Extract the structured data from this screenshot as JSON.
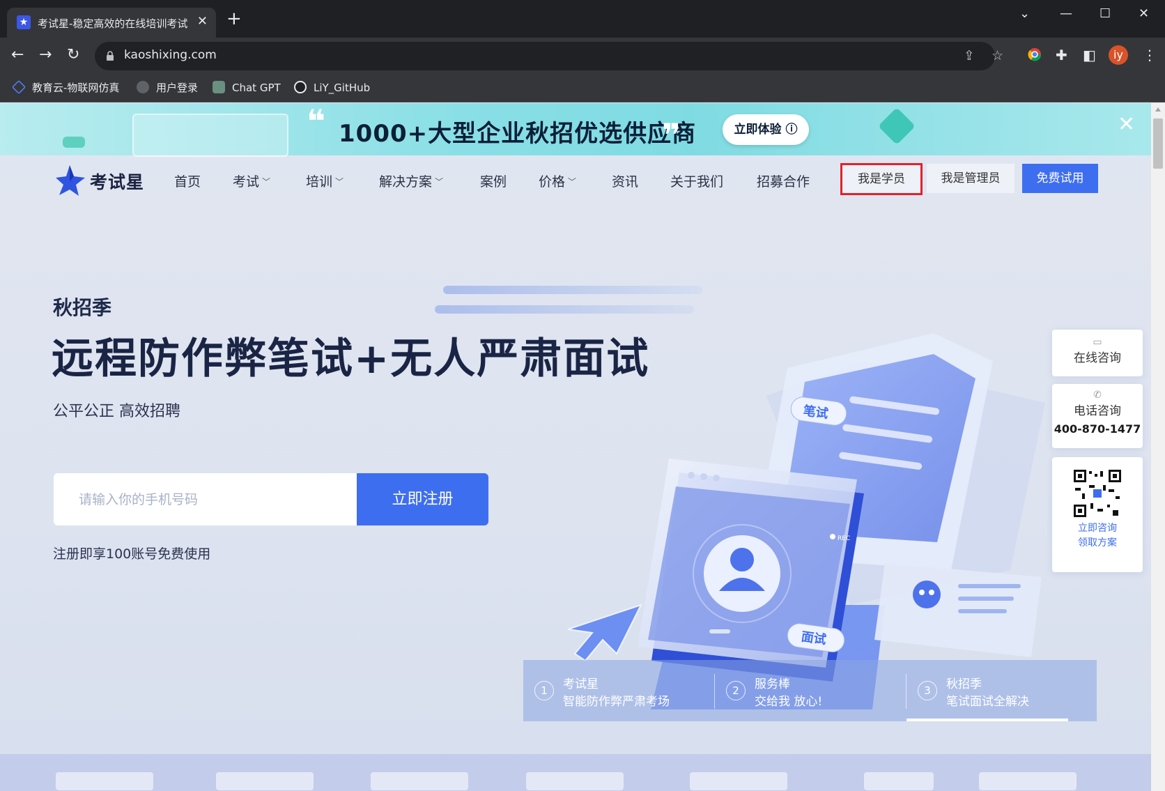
{
  "browser": {
    "tab_title": "考试星-稳定高效的在线培训考试",
    "tab_favicon": "★",
    "tab_close": "✕",
    "new_tab": "+",
    "url": "kaoshixing.com",
    "profile_initials": "iy",
    "window_controls": {
      "tab_search": "⌄",
      "minimize": "—",
      "maximize": "☐",
      "close": "✕"
    },
    "bookmarks": [
      {
        "label": "教育云-物联网仿真",
        "icon": "diamond-icon"
      },
      {
        "label": "用户登录",
        "icon": "globe-icon"
      },
      {
        "label": "Chat GPT",
        "icon": "openai-icon"
      },
      {
        "label": "LiY_GitHub",
        "icon": "github-icon"
      }
    ]
  },
  "promo": {
    "text": "1000+大型企业秋招优选供应商",
    "button": "立即体验 ⓘ",
    "quote_open": "❝",
    "quote_close": "❞",
    "close": "✕"
  },
  "nav": {
    "logo": "考试星",
    "items": [
      {
        "label": "首页",
        "caret": false
      },
      {
        "label": "考试",
        "caret": true
      },
      {
        "label": "培训",
        "caret": true
      },
      {
        "label": "解决方案",
        "caret": true
      },
      {
        "label": "案例",
        "caret": false
      },
      {
        "label": "价格",
        "caret": true
      },
      {
        "label": "资讯",
        "caret": false
      },
      {
        "label": "关于我们",
        "caret": false
      },
      {
        "label": "招募合作",
        "caret": false
      }
    ],
    "btn_student": "我是学员",
    "btn_admin": "我是管理员",
    "btn_trial": "免费试用"
  },
  "hero": {
    "kicker": "秋招季",
    "title": "远程防作弊笔试+无人严肃面试",
    "subtitle": "公平公正 高效招聘",
    "phone_placeholder": "请输入你的手机号码",
    "register": "立即注册",
    "note": "注册即享100账号免费使用",
    "illus_tag_written": "笔试",
    "illus_tag_interview": "面试",
    "illus_rec": "REC"
  },
  "side": {
    "online": "在线咨询",
    "phone_label": "电话咨询",
    "phone_number": "400-870-1477",
    "qr_link_1": "立即咨询",
    "qr_link_2": "领取方案"
  },
  "features": [
    {
      "num": "1",
      "title": "考试星",
      "desc": "智能防作弊严肃考场"
    },
    {
      "num": "2",
      "title": "服务棒",
      "desc": "交给我 放心!"
    },
    {
      "num": "3",
      "title": "秋招季",
      "desc": "笔试面试全解决"
    }
  ],
  "colors": {
    "brand_blue": "#3e6ef0",
    "highlight_red": "#e5202b",
    "promo_teal": "#7fdbe2",
    "title_dark": "#1a2545"
  }
}
